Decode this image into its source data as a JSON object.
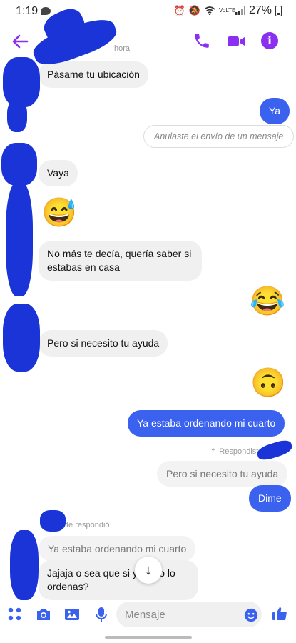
{
  "status_bar": {
    "time": "1:19",
    "battery": "27%",
    "network": "VoLTE"
  },
  "header": {
    "subtitle": "hora",
    "icons": [
      "back-arrow-icon",
      "phone-icon",
      "video-camera-icon",
      "info-icon"
    ],
    "accent_color": "#8b2ff0"
  },
  "messages": {
    "m1": "Pásame tu ubicación",
    "m2": "Ya",
    "m3": "Anulaste el envío de un mensaje",
    "m4": "Vaya",
    "m5_emoji": "😅",
    "m6": "No más te decía, quería saber si estabas en casa",
    "m7_emoji": "😂",
    "m8": "Pero si necesito tu ayuda",
    "m9_emoji": "🙃",
    "m10": "Ya estaba ordenando mi cuarto",
    "reply_label_out": "Respondiste",
    "reply_quote_out": "Pero si necesito tu ayuda",
    "m11": "Dime",
    "reply_label_in": "te respondió",
    "reply_quote_in": "Ya estaba ordenando mi cuarto",
    "m12": "Jajaja o sea que si ya y no lo ordenas?"
  },
  "scroll_down_icon": "arrow-down-icon",
  "composer": {
    "placeholder": "Mensaje",
    "icons": [
      "grid-icon",
      "camera-icon",
      "image-icon",
      "microphone-icon",
      "emoji-icon",
      "thumbs-up-icon"
    ]
  },
  "colors": {
    "outgoing_bubble": "#3a62ef",
    "incoming_bubble": "#f0f0f0",
    "redaction_scribble": "#1a34d8"
  }
}
